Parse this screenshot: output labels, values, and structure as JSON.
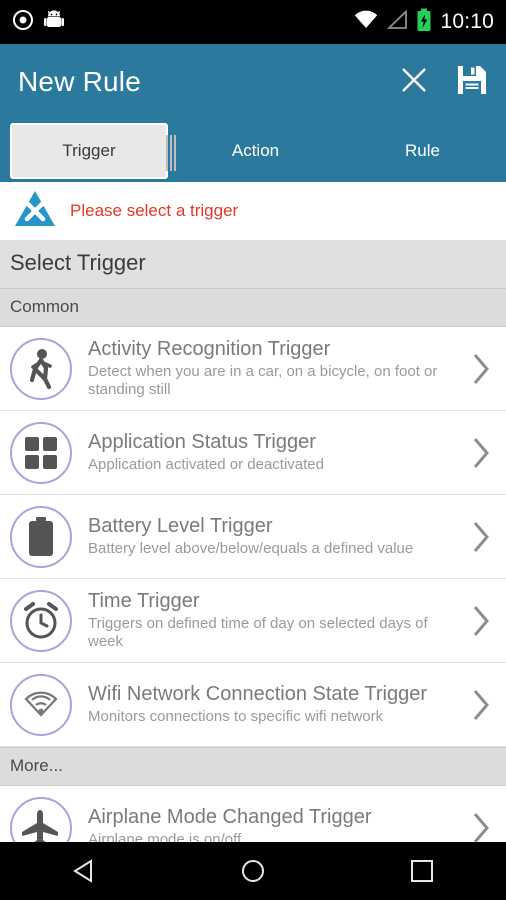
{
  "statusbar": {
    "icons_left": [
      "record-icon",
      "android-icon"
    ],
    "icons_right": [
      "wifi-icon",
      "signal-icon",
      "battery-charging-icon"
    ],
    "clock": "10:10"
  },
  "appbar": {
    "title": "New Rule",
    "actions": [
      {
        "name": "close-icon",
        "label": "Close"
      },
      {
        "name": "save-icon",
        "label": "Save"
      }
    ],
    "background": "#2b7a9e"
  },
  "tabs": [
    {
      "label": "Trigger",
      "selected": true
    },
    {
      "label": "Action",
      "selected": false
    },
    {
      "label": "Rule",
      "selected": false
    }
  ],
  "warning": {
    "icon": "warning-triangle-icon",
    "text": "Please select a trigger",
    "color": "#e8352a"
  },
  "section": {
    "title": "Select Trigger"
  },
  "groups": [
    {
      "header": "Common",
      "items": [
        {
          "icon": "walking-person-icon",
          "title": "Activity Recognition Trigger",
          "subtitle": "Detect when you are in a car, on a bicycle, on foot or standing still"
        },
        {
          "icon": "apps-grid-icon",
          "title": "Application Status Trigger",
          "subtitle": "Application activated or deactivated"
        },
        {
          "icon": "battery-icon",
          "title": "Battery Level Trigger",
          "subtitle": "Battery level above/below/equals a defined value"
        },
        {
          "icon": "alarm-clock-icon",
          "title": "Time Trigger",
          "subtitle": "Triggers on defined time of day on selected days of week"
        },
        {
          "icon": "wifi-signal-icon",
          "title": "Wifi Network Connection State Trigger",
          "subtitle": "Monitors connections to specific wifi network"
        }
      ]
    },
    {
      "header": "More...",
      "items": [
        {
          "icon": "airplane-icon",
          "title": "Airplane Mode Changed Trigger",
          "subtitle": "Airplane mode is on/off"
        }
      ]
    }
  ],
  "navbar": {
    "buttons": [
      {
        "name": "nav-back-button",
        "label": "Back"
      },
      {
        "name": "nav-home-button",
        "label": "Home"
      },
      {
        "name": "nav-recents-button",
        "label": "Recents"
      }
    ]
  }
}
